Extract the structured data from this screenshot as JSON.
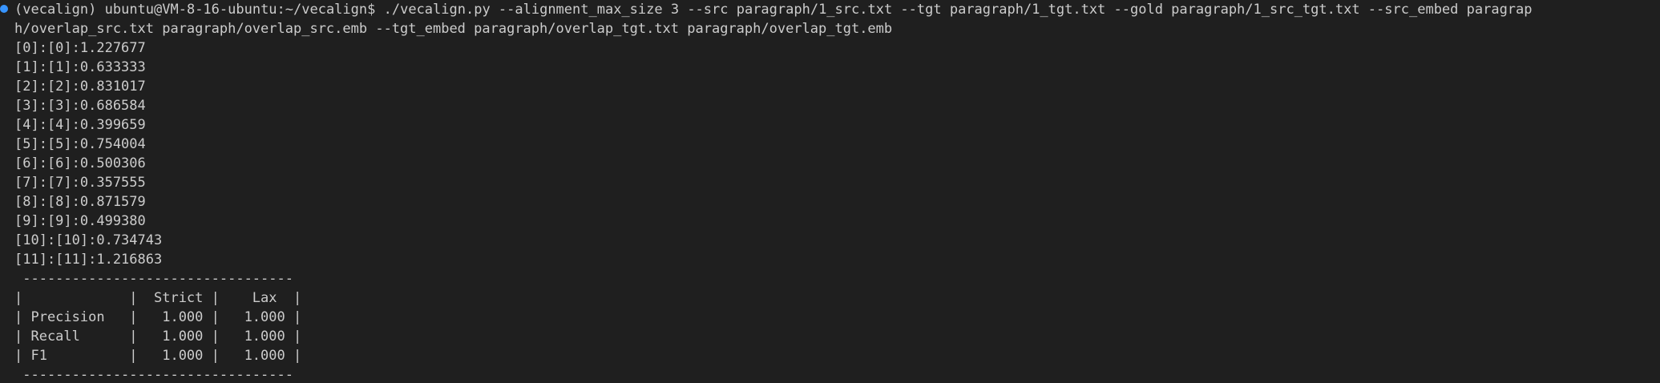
{
  "terminal": {
    "prompt": {
      "env": "(vecalign)",
      "user_host_path": "ubuntu@VM-8-16-ubuntu:~/vecalign$",
      "command_line_1": "./vecalign.py --alignment_max_size 3 --src paragraph/1_src.txt --tgt paragraph/1_tgt.txt --gold paragraph/1_src_tgt.txt --src_embed paragrap",
      "command_line_2": "h/overlap_src.txt paragraph/overlap_src.emb --tgt_embed paragraph/overlap_tgt.txt paragraph/overlap_tgt.emb"
    },
    "alignments": [
      "[0]:[0]:1.227677",
      "[1]:[1]:0.633333",
      "[2]:[2]:0.831017",
      "[3]:[3]:0.686584",
      "[4]:[4]:0.399659",
      "[5]:[5]:0.754004",
      "[6]:[6]:0.500306",
      "[7]:[7]:0.357555",
      "[8]:[8]:0.871579",
      "[9]:[9]:0.499380",
      "[10]:[10]:0.734743",
      "[11]:[11]:1.216863"
    ],
    "table_lines": [
      " ---------------------------------",
      "|             |  Strict |    Lax  |",
      "| Precision   |   1.000 |   1.000 |",
      "| Recall      |   1.000 |   1.000 |",
      "| F1          |   1.000 |   1.000 |",
      " ---------------------------------"
    ],
    "colors": {
      "background": "#1f1f1f",
      "text": "#cccccc",
      "command_decoration": "#3794ff"
    }
  }
}
